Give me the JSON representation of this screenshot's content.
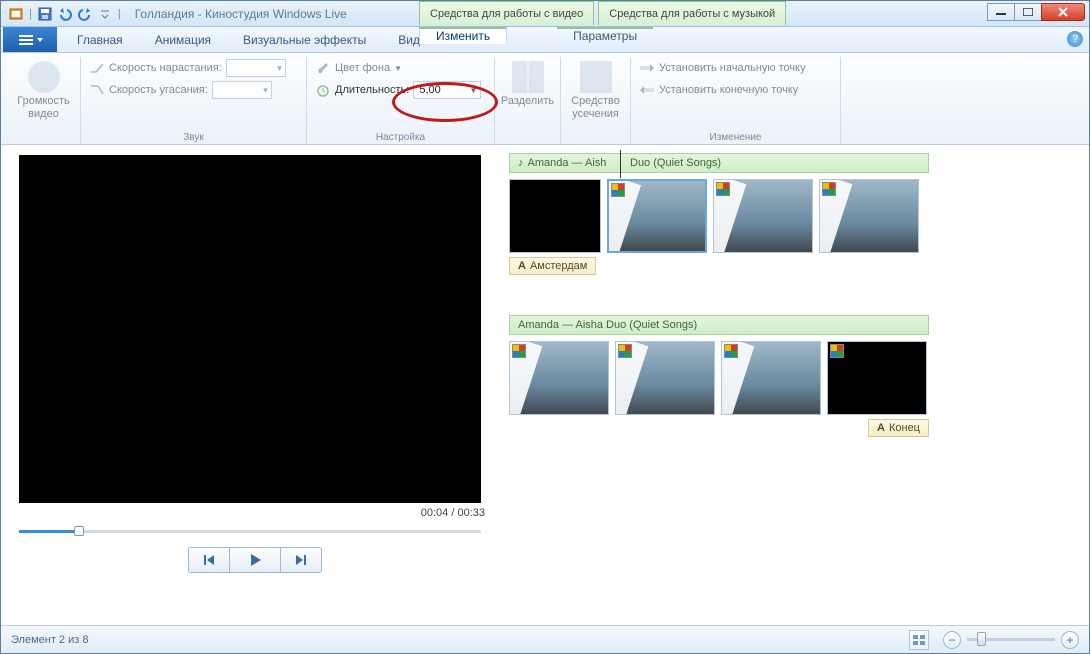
{
  "title": "Голландия - Киностудия Windows Live",
  "context_tabs": {
    "video": "Средства для работы с видео",
    "music": "Средства для работы с музыкой"
  },
  "tabs": {
    "main": "Главная",
    "animation": "Анимация",
    "effects": "Визуальные эффекты",
    "view": "Вид",
    "edit": "Изменить",
    "options": "Параметры"
  },
  "ribbon": {
    "volume": {
      "label": "Громкость\nвидео"
    },
    "sound_group": "Звук",
    "rise_speed": "Скорость нарастания:",
    "fall_speed": "Скорость угасания:",
    "settings_group": "Настройка",
    "bg_color": "Цвет фона",
    "duration_label": "Длительность:",
    "duration_value": "5,00",
    "split": "Разделить",
    "crop_tool": "Средство усечения",
    "set_start": "Установить начальную точку",
    "set_end": "Установить конечную точку",
    "edit_group": "Изменение"
  },
  "preview": {
    "time": "00:04 / 00:33"
  },
  "storyboard": {
    "audio1": "Amanda — Aisha Duo (Quiet Songs)",
    "audio1_short": "Amanda — Aish",
    "audio1_rest": "Duo (Quiet Songs)",
    "text1": "Амстердам",
    "audio2": "Amanda — Aisha Duo (Quiet Songs)",
    "text2": "Конец"
  },
  "status": {
    "item": "Элемент 2 из 8"
  }
}
